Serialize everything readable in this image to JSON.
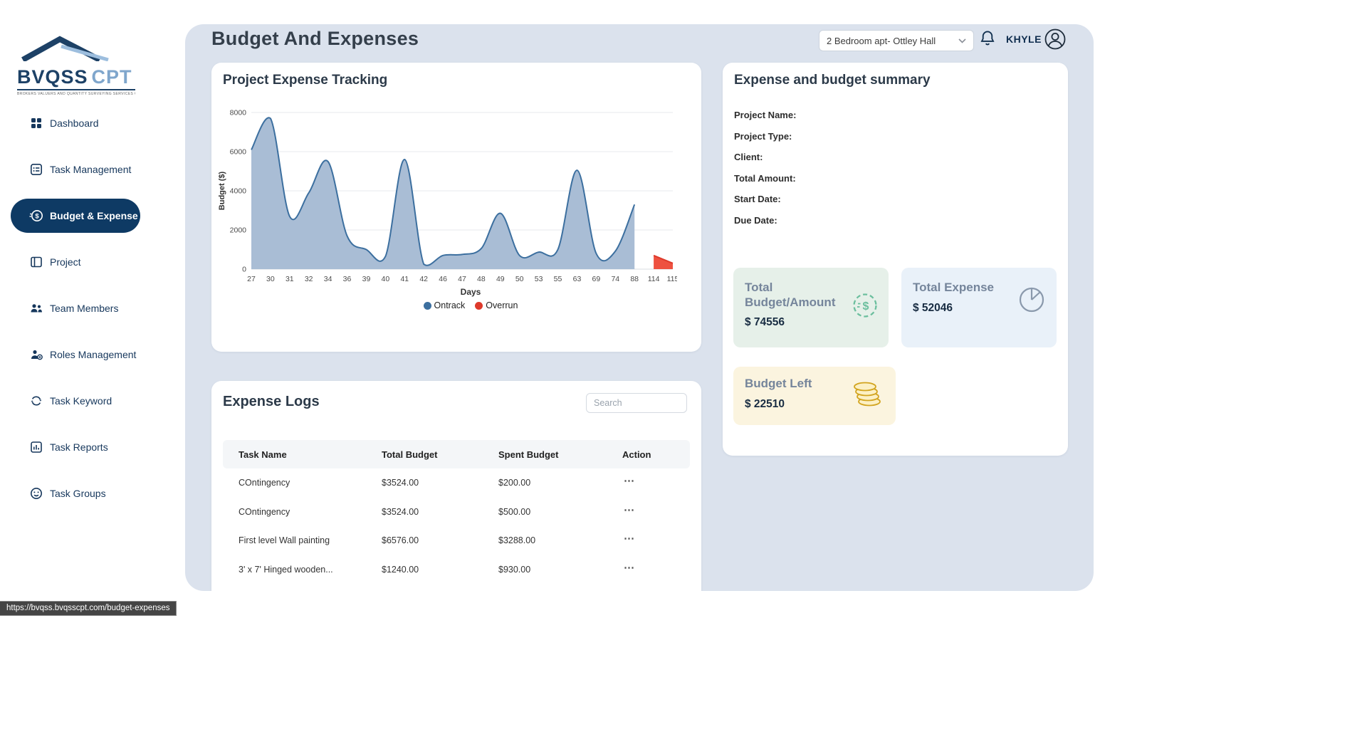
{
  "logo": {
    "primary": "BVQSS",
    "secondary": "CPT",
    "tagline": "BROKERS VALUERS AND QUANTITY SURVEYING SERVICES CONSTRUCTION PROJECT TRACKER"
  },
  "sidebar": {
    "items": [
      {
        "label": "Dashboard",
        "icon": "dashboard-icon",
        "active": false
      },
      {
        "label": "Task Management",
        "icon": "task-management-icon",
        "active": false
      },
      {
        "label": "Budget & Expense",
        "icon": "budget-expense-icon",
        "active": true
      },
      {
        "label": "Project",
        "icon": "project-icon",
        "active": false
      },
      {
        "label": "Team Members",
        "icon": "team-members-icon",
        "active": false
      },
      {
        "label": "Roles Management",
        "icon": "roles-management-icon",
        "active": false
      },
      {
        "label": "Task Keyword",
        "icon": "task-keyword-icon",
        "active": false
      },
      {
        "label": "Task Reports",
        "icon": "task-reports-icon",
        "active": false
      },
      {
        "label": "Task Groups",
        "icon": "task-groups-icon",
        "active": false
      }
    ]
  },
  "header": {
    "title": "Budget And Expenses",
    "project_selector": {
      "value": "2 Bedroom apt- Ottley Hall"
    },
    "user_name": "KHYLE"
  },
  "chart_data": {
    "type": "area",
    "title": "Project Expense Tracking",
    "xlabel": "Days",
    "ylabel": "Budget ($)",
    "ylim": [
      0,
      8000
    ],
    "yticks": [
      0,
      2000,
      4000,
      6000,
      8000
    ],
    "grid": true,
    "legend_position": "bottom",
    "categories": [
      "27",
      "30",
      "31",
      "32",
      "34",
      "36",
      "39",
      "40",
      "41",
      "42",
      "46",
      "47",
      "48",
      "49",
      "50",
      "53",
      "55",
      "63",
      "69",
      "74",
      "88",
      "114",
      "115"
    ],
    "series": [
      {
        "name": "Ontrack",
        "color": "#3c6f9f",
        "fill": "#a9bdd5",
        "values": [
          6100,
          7700,
          2700,
          3900,
          5500,
          1700,
          1000,
          650,
          5600,
          250,
          700,
          750,
          1050,
          2850,
          700,
          870,
          1000,
          5050,
          800,
          920,
          3300,
          null,
          null
        ]
      },
      {
        "name": "Overrun",
        "color": "#de3a2b",
        "fill": "#ee5140",
        "values": [
          null,
          null,
          null,
          null,
          null,
          null,
          null,
          null,
          null,
          null,
          null,
          null,
          null,
          null,
          null,
          null,
          null,
          null,
          null,
          null,
          null,
          700,
          300
        ]
      }
    ]
  },
  "expense_logs": {
    "title": "Expense Logs",
    "search_placeholder": "Search",
    "columns": [
      "Task Name",
      "Total Budget",
      "Spent Budget",
      "Action"
    ],
    "actions_glyph": "⋯",
    "rows": [
      {
        "task": "COntingency",
        "total": "$3524.00",
        "spent": "$200.00"
      },
      {
        "task": "COntingency",
        "total": "$3524.00",
        "spent": "$500.00"
      },
      {
        "task": "First level Wall painting",
        "total": "$6576.00",
        "spent": "$3288.00"
      },
      {
        "task": "3' x 7' Hinged wooden...",
        "total": "$1240.00",
        "spent": "$930.00"
      }
    ]
  },
  "summary": {
    "title": "Expense and budget summary",
    "fields": [
      "Project Name:",
      "Project Type:",
      "Client:",
      "Total Amount:",
      "Start Date:",
      "Due Date:"
    ],
    "tiles": [
      {
        "label": "Total Budget/Amount",
        "value": "$ 74556",
        "bg": "#e6f0e9",
        "icon": "dollar-coin-icon"
      },
      {
        "label": "Total Expense",
        "value": "$ 52046",
        "bg": "#e9f1f9",
        "icon": "pie-chart-icon"
      },
      {
        "label": "Budget Left",
        "value": "$ 22510",
        "bg": "#fbf4df",
        "icon": "coins-icon"
      }
    ]
  },
  "status_bar": {
    "url": "https://bvqss.bvqsscpt.com/budget-expenses"
  },
  "colors": {
    "accent_navy": "#0e3a64",
    "panel_bg": "#dbe2ed",
    "ontrack": "#3c6f9f",
    "overrun": "#de3a2b"
  }
}
